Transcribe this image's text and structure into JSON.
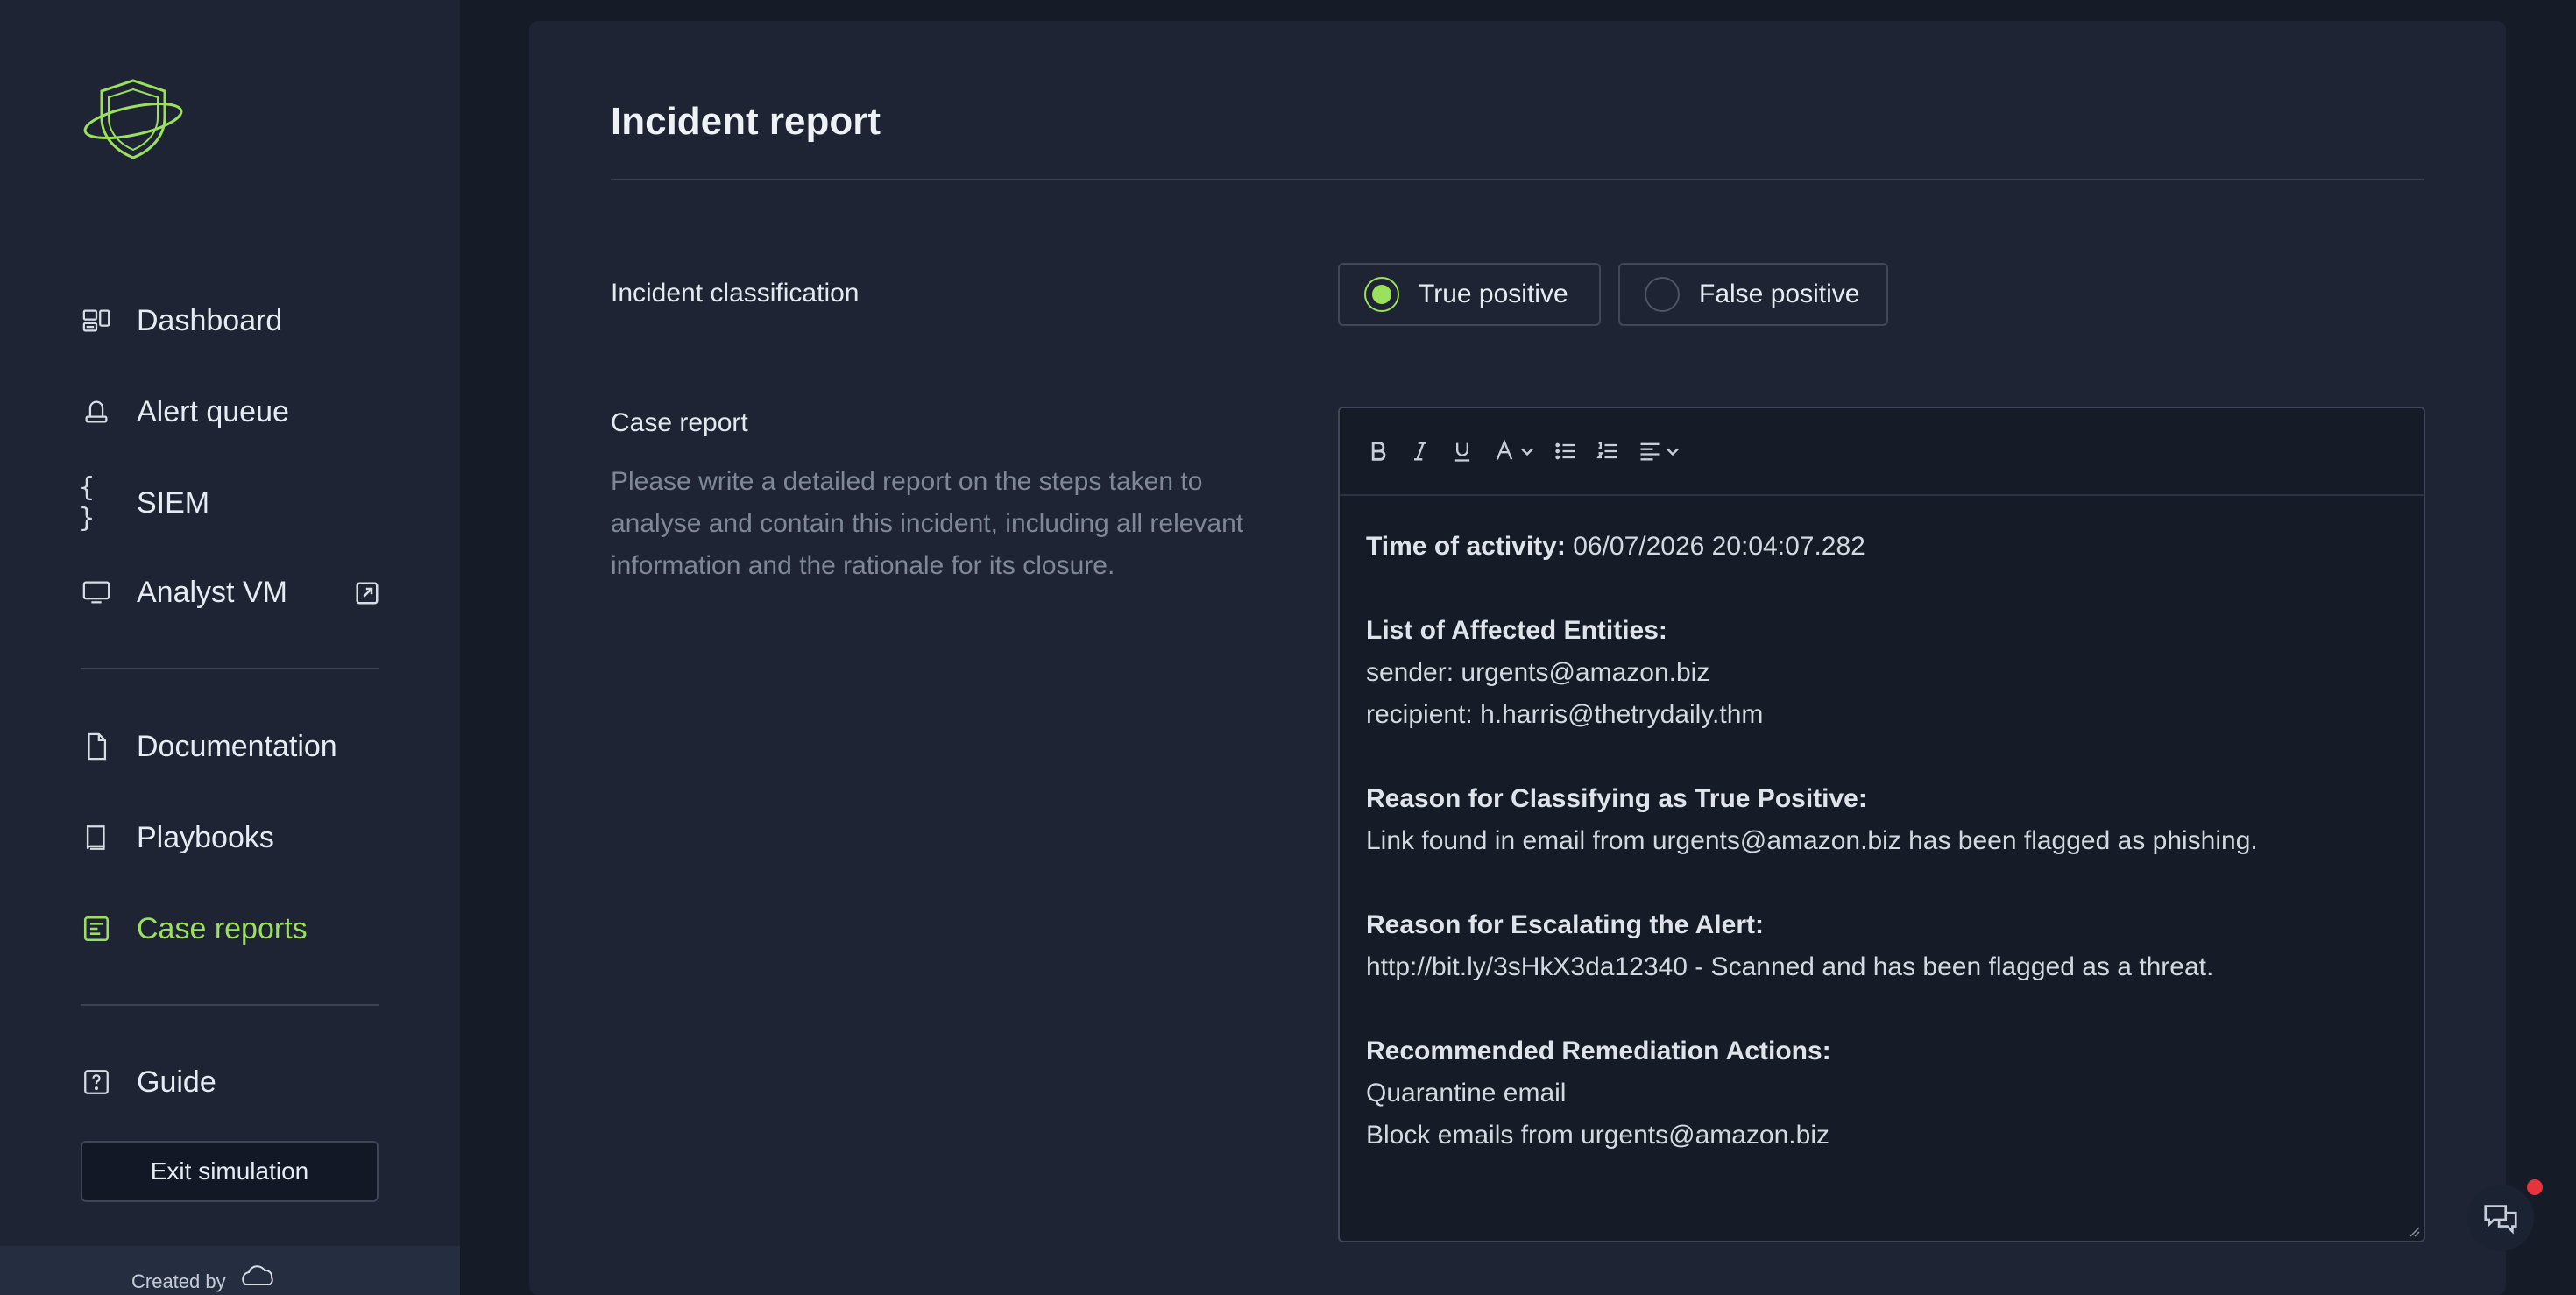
{
  "sidebar": {
    "items": [
      {
        "label": "Dashboard",
        "icon": "dashboard-icon"
      },
      {
        "label": "Alert queue",
        "icon": "alert-queue-icon"
      },
      {
        "label": "SIEM",
        "icon": "braces-icon"
      },
      {
        "label": "Analyst VM",
        "icon": "monitor-icon"
      },
      {
        "label": "Documentation",
        "icon": "document-icon"
      },
      {
        "label": "Playbooks",
        "icon": "book-icon"
      },
      {
        "label": "Case reports",
        "icon": "case-reports-icon",
        "active": true
      },
      {
        "label": "Guide",
        "icon": "help-icon"
      }
    ],
    "exit_label": "Exit simulation",
    "created_by": "Created by",
    "accent": "#9be15d"
  },
  "main": {
    "title": "Incident report",
    "classification_label": "Incident classification",
    "options": [
      {
        "label": "True positive",
        "checked": true
      },
      {
        "label": "False positive",
        "checked": false
      }
    ],
    "case_report_label": "Case report",
    "case_report_help": "Please write a detailed report on the steps taken to analyse and contain this incident, including all relevant information and the rationale for its closure."
  },
  "editor": {
    "toolbar": [
      "bold-icon",
      "italic-icon",
      "underline-icon",
      "text-color-icon",
      "bullet-list-icon",
      "numbered-list-icon",
      "align-icon"
    ],
    "time_label": "Time of activity:",
    "time_value": "06/07/2026 20:04:07.282",
    "entities_label": "List of Affected Entities:",
    "sender": "sender: urgents@amazon.biz",
    "recipient": "recipient: h.harris@thetrydaily.thm",
    "reason_tp_label": "Reason for Classifying as True Positive:",
    "reason_tp_text": "Link found in email from urgents@amazon.biz has been flagged as phishing.",
    "reason_esc_label": "Reason for Escalating the Alert:",
    "reason_esc_text": "http://bit.ly/3sHkX3da12340 - Scanned and has been flagged as a threat.",
    "remediation_label": "Recommended Remediation Actions:",
    "remediation_1": "Quarantine email",
    "remediation_2": "Block emails from urgents@amazon.biz"
  }
}
